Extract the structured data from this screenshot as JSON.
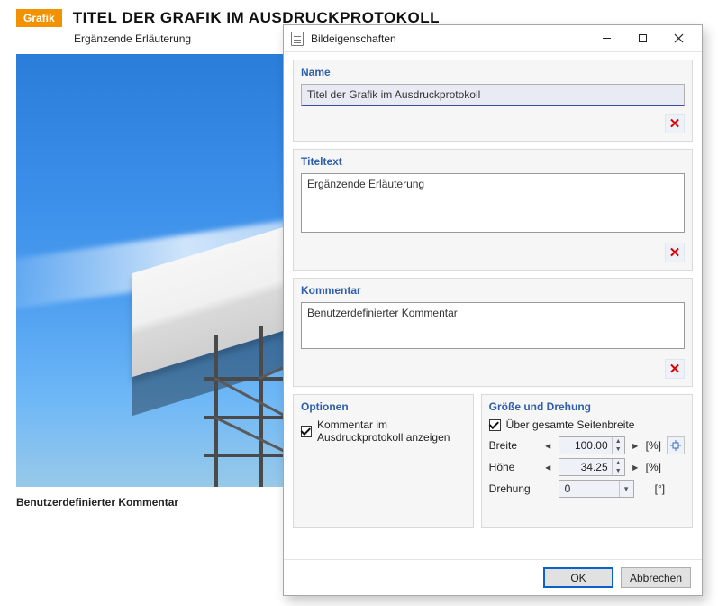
{
  "page": {
    "tag": "Grafik",
    "title": "TITEL DER GRAFIK IM AUSDRUCKPROTOKOLL",
    "subtitle": "Ergänzende Erläuterung",
    "photo_comment": "Benutzerdefinierter Kommentar"
  },
  "dialog": {
    "title": "Bildeigenschaften",
    "sections": {
      "name": {
        "label": "Name",
        "value": "Titel der Grafik im Ausdruckprotokoll"
      },
      "titletext": {
        "label": "Titeltext",
        "value": "Ergänzende Erläuterung"
      },
      "comment": {
        "label": "Kommentar",
        "value": "Benutzerdefinierter Kommentar"
      },
      "options": {
        "label": "Optionen",
        "show_comment_label": "Kommentar im Ausdruckprotokoll anzeigen",
        "show_comment_checked": true
      },
      "size": {
        "label": "Größe und Drehung",
        "full_width_label": "Über gesamte Seitenbreite",
        "full_width_checked": true,
        "width_label": "Breite",
        "width_value": "100.00",
        "width_unit": "[%]",
        "height_label": "Höhe",
        "height_value": "34.25",
        "height_unit": "[%]",
        "rotation_label": "Drehung",
        "rotation_value": "0",
        "rotation_unit": "[°]"
      }
    },
    "buttons": {
      "ok": "OK",
      "cancel": "Abbrechen"
    }
  }
}
